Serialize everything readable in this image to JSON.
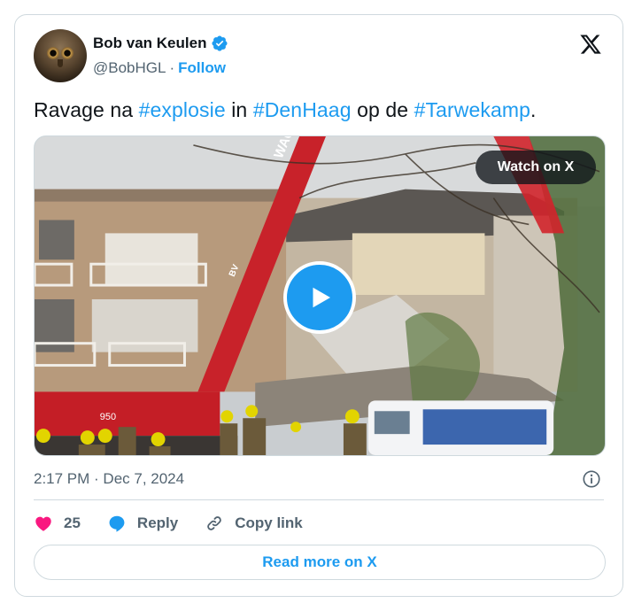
{
  "author": {
    "display_name": "Bob van Keulen",
    "handle": "@BobHGL",
    "separator": "·",
    "follow_label": "Follow",
    "verified": true,
    "avatar_icon": "owl-avatar"
  },
  "brand_icon": "x-logo-icon",
  "tweet": {
    "segments": [
      {
        "text": "Ravage na ",
        "hashtag": false
      },
      {
        "text": "#explosie",
        "hashtag": true
      },
      {
        "text": " in ",
        "hashtag": false
      },
      {
        "text": "#DenHaag",
        "hashtag": true
      },
      {
        "text": " op de ",
        "hashtag": false
      },
      {
        "text": "#Tarwekamp",
        "hashtag": true
      },
      {
        "text": ".",
        "hashtag": false
      }
    ]
  },
  "media": {
    "type": "video",
    "watch_label": "Watch on X",
    "crane_lettering": "WAGENBURG",
    "crane_lettering_bv": "BV",
    "crane_model": "950"
  },
  "meta": {
    "timestamp": "2:17 PM · Dec 7, 2024"
  },
  "actions": {
    "like_count": "25",
    "reply_label": "Reply",
    "copy_link_label": "Copy link"
  },
  "read_more_label": "Read more on X",
  "colors": {
    "accent": "#1d9bf0",
    "text_primary": "#0f1419",
    "text_secondary": "#536471",
    "border": "#cfd9de",
    "like": "#f91880"
  }
}
